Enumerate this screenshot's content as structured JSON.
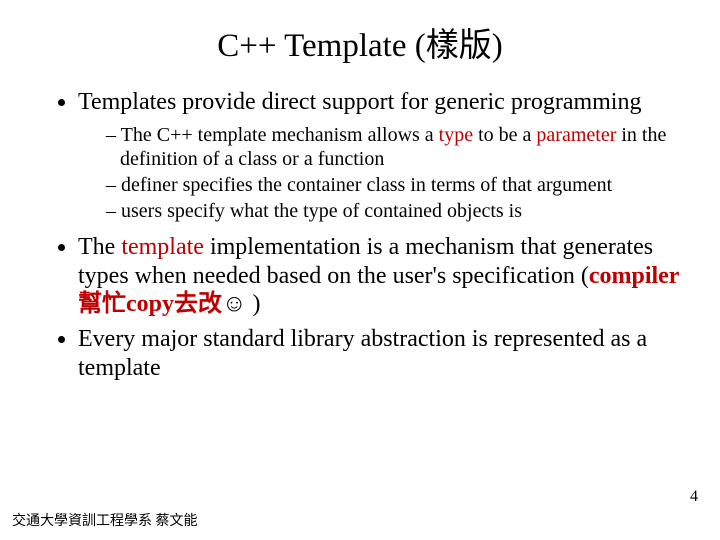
{
  "title": "C++ Template (樣版)",
  "bullets": {
    "b1": "Templates provide direct support for generic programming",
    "s1a_pre": "The C++ template mechanism allows a ",
    "s1a_type": "type",
    "s1a_mid": " to be a ",
    "s1a_param": "parameter",
    "s1a_post": " in the definition of a class or a function",
    "s1b": "definer specifies the container class in terms of that argument",
    "s1c": "users specify what the type of contained objects is",
    "b2_pre": "The ",
    "b2_tmpl": "template",
    "b2_mid": " implementation is a mechanism that generates types when needed based on the user's specification  (",
    "b2_compiler": "compiler 幫忙copy去改",
    "b2_smile": "☺",
    "b2_end": " )",
    "b3": "Every major standard library abstraction is represented as a template"
  },
  "footer": "交通大學資訓工程學系 蔡文能",
  "page": "4"
}
